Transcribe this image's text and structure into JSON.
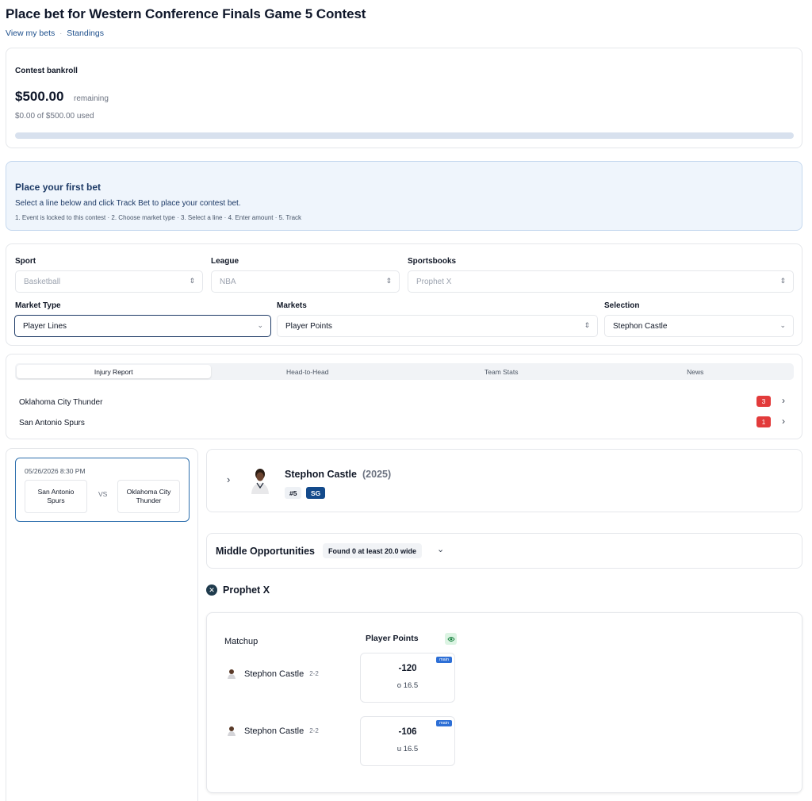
{
  "page": {
    "title": "Place bet for Western Conference Finals Game 5 Contest",
    "links": {
      "view_bets": "View my bets",
      "separator": "·",
      "standings": "Standings"
    }
  },
  "bankroll": {
    "label": "Contest bankroll",
    "amount": "$500.00",
    "remaining": "remaining",
    "used": "$0.00 of $500.00 used",
    "used_fraction": 0.0
  },
  "first_bet": {
    "heading": "Place your first bet",
    "description": "Select a line below and click Track Bet to place your contest bet.",
    "steps": "1. Event is locked to this contest · 2. Choose market type · 3. Select a line · 4. Enter amount · 5. Track"
  },
  "filters": {
    "sport": {
      "label": "Sport",
      "value": "Basketball"
    },
    "league": {
      "label": "League",
      "value": "NBA"
    },
    "sportsbooks": {
      "label": "Sportsbooks",
      "value": "Prophet X"
    },
    "market_type": {
      "label": "Market Type",
      "value": "Player Lines"
    },
    "markets": {
      "label": "Markets",
      "value": "Player Points"
    },
    "selection": {
      "label": "Selection",
      "value": "Stephon Castle"
    }
  },
  "tabs": [
    "Injury Report",
    "Head-to-Head",
    "Team Stats",
    "News"
  ],
  "injuries": [
    {
      "team": "Oklahoma City Thunder",
      "count": "3"
    },
    {
      "team": "San Antonio Spurs",
      "count": "1"
    }
  ],
  "game": {
    "datetime": "05/26/2026 8:30 PM",
    "away": "San Antonio Spurs",
    "vs": "VS",
    "home": "Oklahoma City Thunder"
  },
  "player": {
    "name": "Stephon Castle",
    "year": "(2025)",
    "number": "#5",
    "position": "SG"
  },
  "middle": {
    "title": "Middle Opportunities",
    "found": "Found 0 at least 20.0 wide"
  },
  "sportsbook": {
    "name": "Prophet X",
    "icon": "prophet-x-logo-icon"
  },
  "odds_table": {
    "matchup_header": "Matchup",
    "market_header": "Player Points",
    "rows": [
      {
        "player": "Stephon Castle",
        "record": "2-2",
        "tag": "main",
        "price": "-120",
        "line": "o 16.5"
      },
      {
        "player": "Stephon Castle",
        "record": "2-2",
        "tag": "main",
        "price": "-106",
        "line": "u 16.5"
      }
    ]
  },
  "colors": {
    "accent": "#1d4f8c",
    "badge_red": "#e23b3b",
    "chip_navy": "#134a8b",
    "tag_blue": "#2d6fd6"
  }
}
